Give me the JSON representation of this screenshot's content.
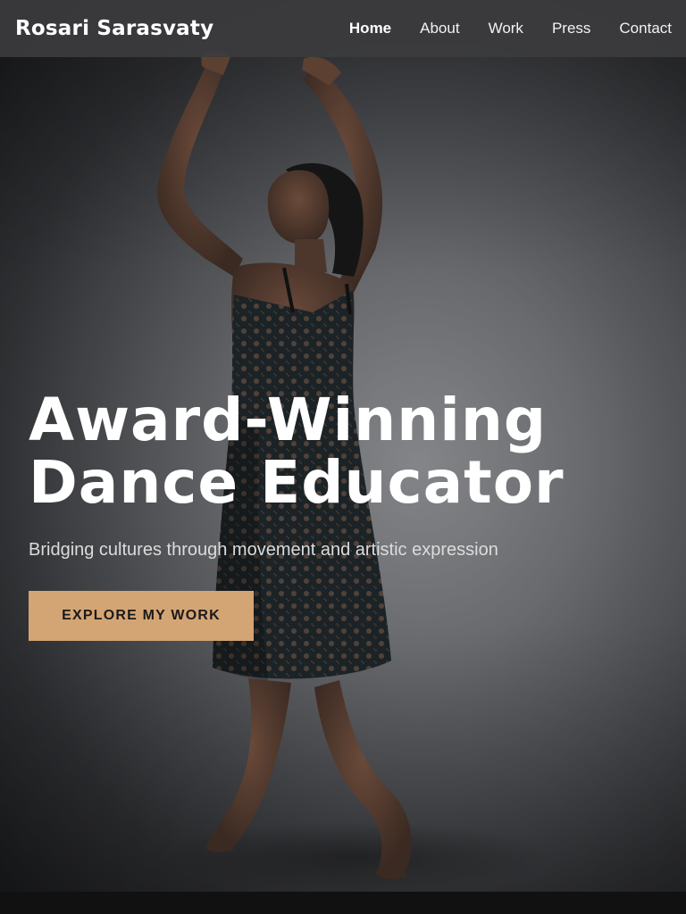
{
  "site": {
    "brand": "Rosari Sarasvaty"
  },
  "nav": {
    "items": [
      {
        "label": "Home",
        "active": true
      },
      {
        "label": "About",
        "active": false
      },
      {
        "label": "Work",
        "active": false
      },
      {
        "label": "Press",
        "active": false
      },
      {
        "label": "Contact",
        "active": false
      }
    ]
  },
  "hero": {
    "title_line1": "Award-Winning",
    "title_line2": "Dance Educator",
    "subtitle": "Bridging cultures through movement and artistic expression",
    "cta_label": "EXPLORE MY WORK",
    "image_subject": "dancer-in-black-lace-dress",
    "accent_color": "#d4a574"
  }
}
